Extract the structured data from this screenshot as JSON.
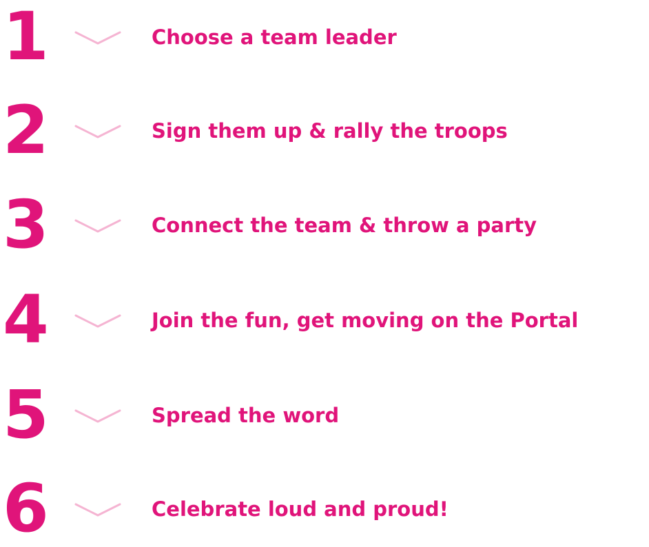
{
  "steps": [
    {
      "number": "1",
      "label": "Choose a team leader"
    },
    {
      "number": "2",
      "label": "Sign them up & rally the troops"
    },
    {
      "number": "3",
      "label": "Connect the team & throw a party"
    },
    {
      "number": "4",
      "label": "Join the fun, get moving on the Portal"
    },
    {
      "number": "5",
      "label": "Spread the word"
    },
    {
      "number": "6",
      "label": "Celebrate loud and proud!"
    }
  ],
  "colors": {
    "accent": "#E0147A",
    "chevron": "#F5B4D2",
    "background": "#FFFFFF"
  },
  "icons": {
    "step_divider": "chevron-down-icon"
  }
}
